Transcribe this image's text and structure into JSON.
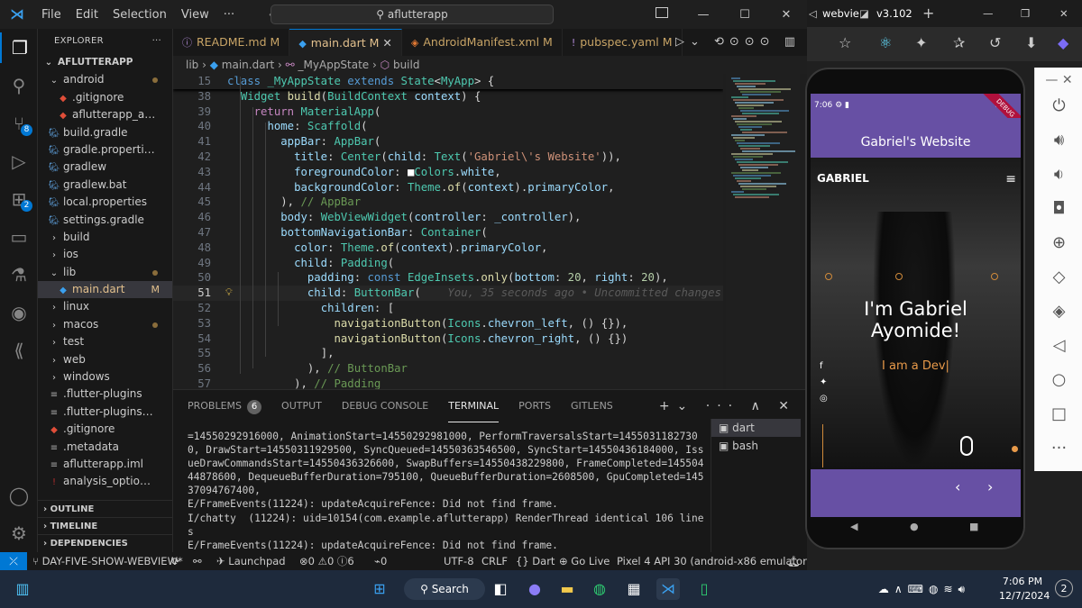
{
  "titlebar": {
    "menu": [
      "File",
      "Edit",
      "Selection",
      "View",
      "···"
    ],
    "search": "aflutterapp"
  },
  "activity": {
    "source_control_badge": "8",
    "extensions_badge": "2"
  },
  "explorer": {
    "header": "EXPLORER",
    "root": "AFLUTTERAPP",
    "items": [
      {
        "label": "android",
        "indent": 1,
        "kind": "folder-open",
        "status": "dot"
      },
      {
        "label": ".gitignore",
        "indent": 2,
        "kind": "git"
      },
      {
        "label": "aflutterapp_android...",
        "indent": 2,
        "kind": "git"
      },
      {
        "label": "build.gradle",
        "indent": 1,
        "kind": "gradle"
      },
      {
        "label": "gradle.properties",
        "indent": 1,
        "kind": "gradle"
      },
      {
        "label": "gradlew",
        "indent": 1,
        "kind": "gradle"
      },
      {
        "label": "gradlew.bat",
        "indent": 1,
        "kind": "gradle"
      },
      {
        "label": "local.properties",
        "indent": 1,
        "kind": "gradle"
      },
      {
        "label": "settings.gradle",
        "indent": 1,
        "kind": "gradle"
      },
      {
        "label": "build",
        "indent": 1,
        "kind": "folder"
      },
      {
        "label": "ios",
        "indent": 1,
        "kind": "folder"
      },
      {
        "label": "lib",
        "indent": 1,
        "kind": "folder-open",
        "status": "dot"
      },
      {
        "label": "main.dart",
        "indent": 2,
        "kind": "dart",
        "status": "M",
        "selected": true
      },
      {
        "label": "linux",
        "indent": 1,
        "kind": "folder"
      },
      {
        "label": "macos",
        "indent": 1,
        "kind": "folder",
        "status": "dot"
      },
      {
        "label": "test",
        "indent": 1,
        "kind": "folder"
      },
      {
        "label": "web",
        "indent": 1,
        "kind": "folder"
      },
      {
        "label": "windows",
        "indent": 1,
        "kind": "folder"
      },
      {
        "label": ".flutter-plugins",
        "indent": 1,
        "kind": "file"
      },
      {
        "label": ".flutter-plugins-depe...",
        "indent": 1,
        "kind": "file"
      },
      {
        "label": ".gitignore",
        "indent": 1,
        "kind": "git"
      },
      {
        "label": ".metadata",
        "indent": 1,
        "kind": "file"
      },
      {
        "label": "aflutterapp.iml",
        "indent": 1,
        "kind": "file"
      },
      {
        "label": "analysis_options.yaml",
        "indent": 1,
        "kind": "yaml"
      }
    ],
    "sections": [
      "OUTLINE",
      "TIMELINE",
      "DEPENDENCIES"
    ]
  },
  "tabs": [
    {
      "label": "README.md",
      "status": "M",
      "icon": "ⓘ"
    },
    {
      "label": "main.dart",
      "status": "M",
      "icon": "◆",
      "active": true
    },
    {
      "label": "AndroidManifest.xml",
      "status": "M",
      "icon": "◈"
    },
    {
      "label": "pubspec.yaml",
      "status": "M",
      "icon": "!"
    }
  ],
  "breadcrumb": [
    "lib",
    "main.dart",
    "_MyAppState",
    "build"
  ],
  "code": {
    "sticky": {
      "num": "15",
      "text": "class _MyAppState extends State<MyApp> {"
    },
    "lines": [
      {
        "num": "38",
        "text": "  Widget build(BuildContext context) {"
      },
      {
        "num": "39",
        "text": "    return MaterialApp("
      },
      {
        "num": "40",
        "text": "      home: Scaffold("
      },
      {
        "num": "41",
        "text": "        appBar: AppBar("
      },
      {
        "num": "42",
        "text": "          title: Center(child: Text('Gabriel\\'s Website')),"
      },
      {
        "num": "43",
        "text": "          foregroundColor: ■Colors.white,"
      },
      {
        "num": "44",
        "text": "          backgroundColor: Theme.of(context).primaryColor,"
      },
      {
        "num": "45",
        "text": "        ), // AppBar"
      },
      {
        "num": "46",
        "text": "        body: WebViewWidget(controller: _controller),"
      },
      {
        "num": "47",
        "text": "        bottomNavigationBar: Container("
      },
      {
        "num": "48",
        "text": "          color: Theme.of(context).primaryColor,"
      },
      {
        "num": "49",
        "text": "          child: Padding("
      },
      {
        "num": "50",
        "text": "            padding: const EdgeInsets.only(bottom: 20, right: 20),"
      },
      {
        "num": "51",
        "text": "            child: ButtonBar(",
        "ghost": "You, 35 seconds ago • Uncommitted changes",
        "current": true
      },
      {
        "num": "52",
        "text": "              children: ["
      },
      {
        "num": "53",
        "text": "                navigationButton(Icons.chevron_left, () {}),"
      },
      {
        "num": "54",
        "text": "                navigationButton(Icons.chevron_right, () {})"
      },
      {
        "num": "55",
        "text": "              ],"
      },
      {
        "num": "56",
        "text": "            ), // ButtonBar"
      },
      {
        "num": "57",
        "text": "          ), // Padding"
      }
    ]
  },
  "panel": {
    "tabs": [
      "PROBLEMS",
      "OUTPUT",
      "DEBUG CONSOLE",
      "TERMINAL",
      "PORTS",
      "GITLENS"
    ],
    "problems_count": "6",
    "active_tab": "TERMINAL",
    "terminal_lines": [
      "=14550292916000, AnimationStart=14550292981000, PerformTraversalsStart=14550311827300, DrawStart=14550311929500, SyncQueued=14550363546500, SyncStart=14550436184000, IssueDrawCommandsStart=14550436326600, SwapBuffers=14550438229800, FrameCompleted=14550444878600, DequeueBufferDuration=795100, QueueBufferDuration=2608500, GpuCompleted=14537094767400,",
      "E/FrameEvents(11224): updateAcquireFence: Did not find frame.",
      "I/chatty  (11224): uid=10154(com.example.aflutterapp) RenderThread identical 106 lines",
      "E/FrameEvents(11224): updateAcquireFence: Did not find frame.",
      "E/FrameEvents(11224): updateAcquireFence: Did not find frame."
    ],
    "terminals": [
      "dart",
      "bash"
    ]
  },
  "statusbar": {
    "branch": "DAY-FIVE-SHOW-WEBVIEW*",
    "launchpad": "Launchpad",
    "errors": "0",
    "warnings": "0",
    "info": "6",
    "ports": "0",
    "encoding": "UTF-8",
    "eol": "CRLF",
    "language": "Dart",
    "golive": "Go Live",
    "device": "Pixel 4 API 30 (android-x86 emulator)"
  },
  "browser": {
    "tab1": "webvie",
    "tab2": "v3.102"
  },
  "phone": {
    "time": "7:06",
    "appbar_title": "Gabriel's Website",
    "logo": "GABRIEL",
    "headline_1": "I'm Gabriel",
    "headline_2": "Ayomide!",
    "typing": "I am a Dev|",
    "nav_left": "‹",
    "nav_right": "›",
    "debug_ribbon": "DEBUG"
  },
  "taskbar": {
    "search": "Search",
    "time": "7:06 PM",
    "date": "12/7/2024",
    "notifications": "2"
  },
  "colors": {
    "accent": "#0078d4",
    "phone_primary": "#6750a4"
  }
}
